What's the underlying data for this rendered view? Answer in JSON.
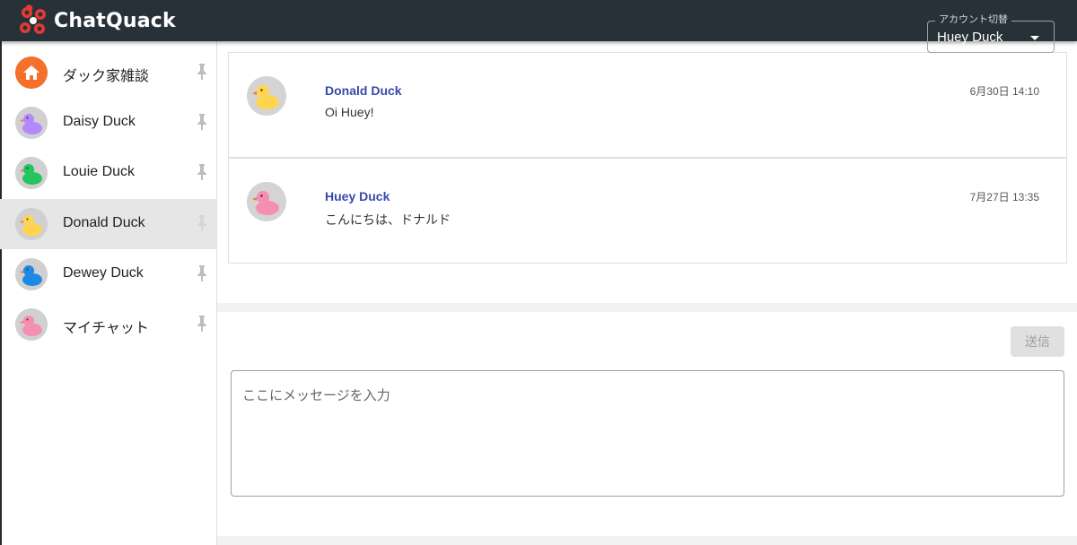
{
  "header": {
    "app_name": "ChatQuack",
    "account_switch_label": "アカウント切替",
    "account_selected": "Huey Duck"
  },
  "sidebar": {
    "items": [
      {
        "label": "ダック家雑談",
        "icon": "home-icon",
        "color": "#f4702b",
        "active": false
      },
      {
        "label": "Daisy Duck",
        "icon": "duck-icon",
        "color": "#b388ff",
        "active": false
      },
      {
        "label": "Louie Duck",
        "icon": "duck-icon",
        "color": "#22c55e",
        "active": false
      },
      {
        "label": "Donald Duck",
        "icon": "duck-icon",
        "color": "#ffd54f",
        "active": true
      },
      {
        "label": "Dewey Duck",
        "icon": "duck-icon",
        "color": "#1e88e5",
        "active": false
      },
      {
        "label": "マイチャット",
        "icon": "duck-icon",
        "color": "#f48fb1",
        "active": false
      }
    ]
  },
  "messages": [
    {
      "sender": "Donald Duck",
      "timestamp": "6月30日 14:10",
      "text": "Oi Huey!",
      "avatar_color": "#ffd54f"
    },
    {
      "sender": "Huey Duck",
      "timestamp": "7月27日 13:35",
      "text": "こんにちは、ドナルド",
      "avatar_color": "#f48fb1"
    }
  ],
  "composer": {
    "send_label": "送信",
    "placeholder": "ここにメッセージを入力"
  },
  "colors": {
    "header_bg": "#263238",
    "sender_name": "#3949ab",
    "active_item_bg": "#e6e6e6"
  }
}
